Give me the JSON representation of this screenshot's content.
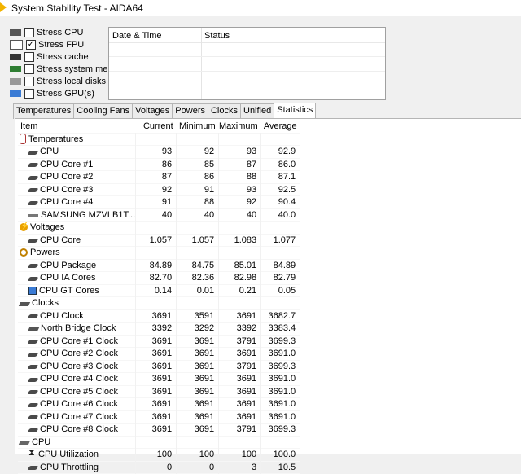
{
  "window": {
    "title": "System Stability Test - AIDA64"
  },
  "options": [
    {
      "label": "Stress CPU",
      "checked": false,
      "icon": "cpu-chip-icon"
    },
    {
      "label": "Stress FPU",
      "checked": true,
      "icon": "fpu-icon"
    },
    {
      "label": "Stress cache",
      "checked": false,
      "icon": "cache-icon"
    },
    {
      "label": "Stress system memory",
      "checked": false,
      "icon": "memory-icon"
    },
    {
      "label": "Stress local disks",
      "checked": false,
      "icon": "disk-icon"
    },
    {
      "label": "Stress GPU(s)",
      "checked": false,
      "icon": "gpu-icon"
    }
  ],
  "log": {
    "col_datetime": "Date & Time",
    "col_status": "Status"
  },
  "tabs": [
    "Temperatures",
    "Cooling Fans",
    "Voltages",
    "Powers",
    "Clocks",
    "Unified",
    "Statistics"
  ],
  "active_tab": "Statistics",
  "stats": {
    "headers": {
      "item": "Item",
      "current": "Current",
      "minimum": "Minimum",
      "maximum": "Maximum",
      "average": "Average"
    },
    "rows": [
      {
        "type": "group",
        "label": "Temperatures",
        "icon": "thermometer-icon"
      },
      {
        "type": "item",
        "label": "CPU",
        "icon": "chip-icon",
        "current": "93",
        "minimum": "92",
        "maximum": "93",
        "average": "92.9"
      },
      {
        "type": "item",
        "label": "CPU Core #1",
        "icon": "chip-icon",
        "current": "86",
        "minimum": "85",
        "maximum": "87",
        "average": "86.0"
      },
      {
        "type": "item",
        "label": "CPU Core #2",
        "icon": "chip-icon",
        "current": "87",
        "minimum": "86",
        "maximum": "88",
        "average": "87.1"
      },
      {
        "type": "item",
        "label": "CPU Core #3",
        "icon": "chip-icon",
        "current": "92",
        "minimum": "91",
        "maximum": "93",
        "average": "92.5"
      },
      {
        "type": "item",
        "label": "CPU Core #4",
        "icon": "chip-icon",
        "current": "91",
        "minimum": "88",
        "maximum": "92",
        "average": "90.4"
      },
      {
        "type": "item",
        "label": "SAMSUNG MZVLB1T...",
        "icon": "ssd-icon",
        "current": "40",
        "minimum": "40",
        "maximum": "40",
        "average": "40.0"
      },
      {
        "type": "group",
        "label": "Voltages",
        "icon": "voltage-icon"
      },
      {
        "type": "item",
        "label": "CPU Core",
        "icon": "chip-icon",
        "current": "1.057",
        "minimum": "1.057",
        "maximum": "1.083",
        "average": "1.077"
      },
      {
        "type": "group",
        "label": "Powers",
        "icon": "power-icon"
      },
      {
        "type": "item",
        "label": "CPU Package",
        "icon": "chip-icon",
        "current": "84.89",
        "minimum": "84.75",
        "maximum": "85.01",
        "average": "84.89"
      },
      {
        "type": "item",
        "label": "CPU IA Cores",
        "icon": "chip-icon",
        "current": "82.70",
        "minimum": "82.36",
        "maximum": "82.98",
        "average": "82.79"
      },
      {
        "type": "item",
        "label": "CPU GT Cores",
        "icon": "gpu-core-icon",
        "current": "0.14",
        "minimum": "0.01",
        "maximum": "0.21",
        "average": "0.05"
      },
      {
        "type": "group",
        "label": "Clocks",
        "icon": "clock-board-icon"
      },
      {
        "type": "item",
        "label": "CPU Clock",
        "icon": "chip-icon",
        "current": "3691",
        "minimum": "3591",
        "maximum": "3691",
        "average": "3682.7"
      },
      {
        "type": "item",
        "label": "North Bridge Clock",
        "icon": "board-icon",
        "current": "3392",
        "minimum": "3292",
        "maximum": "3392",
        "average": "3383.4"
      },
      {
        "type": "item",
        "label": "CPU Core #1 Clock",
        "icon": "chip-icon",
        "current": "3691",
        "minimum": "3691",
        "maximum": "3791",
        "average": "3699.3"
      },
      {
        "type": "item",
        "label": "CPU Core #2 Clock",
        "icon": "chip-icon",
        "current": "3691",
        "minimum": "3691",
        "maximum": "3691",
        "average": "3691.0"
      },
      {
        "type": "item",
        "label": "CPU Core #3 Clock",
        "icon": "chip-icon",
        "current": "3691",
        "minimum": "3691",
        "maximum": "3791",
        "average": "3699.3"
      },
      {
        "type": "item",
        "label": "CPU Core #4 Clock",
        "icon": "chip-icon",
        "current": "3691",
        "minimum": "3691",
        "maximum": "3691",
        "average": "3691.0"
      },
      {
        "type": "item",
        "label": "CPU Core #5 Clock",
        "icon": "chip-icon",
        "current": "3691",
        "minimum": "3691",
        "maximum": "3691",
        "average": "3691.0"
      },
      {
        "type": "item",
        "label": "CPU Core #6 Clock",
        "icon": "chip-icon",
        "current": "3691",
        "minimum": "3691",
        "maximum": "3691",
        "average": "3691.0"
      },
      {
        "type": "item",
        "label": "CPU Core #7 Clock",
        "icon": "chip-icon",
        "current": "3691",
        "minimum": "3691",
        "maximum": "3691",
        "average": "3691.0"
      },
      {
        "type": "item",
        "label": "CPU Core #8 Clock",
        "icon": "chip-icon",
        "current": "3691",
        "minimum": "3691",
        "maximum": "3791",
        "average": "3699.3"
      },
      {
        "type": "group",
        "label": "CPU",
        "icon": "cpu-group-icon"
      },
      {
        "type": "item",
        "label": "CPU Utilization",
        "icon": "hourglass-icon",
        "current": "100",
        "minimum": "100",
        "maximum": "100",
        "average": "100.0"
      },
      {
        "type": "item",
        "label": "CPU Throttling",
        "icon": "chip-icon",
        "current": "0",
        "minimum": "0",
        "maximum": "3",
        "average": "10.5"
      }
    ]
  }
}
